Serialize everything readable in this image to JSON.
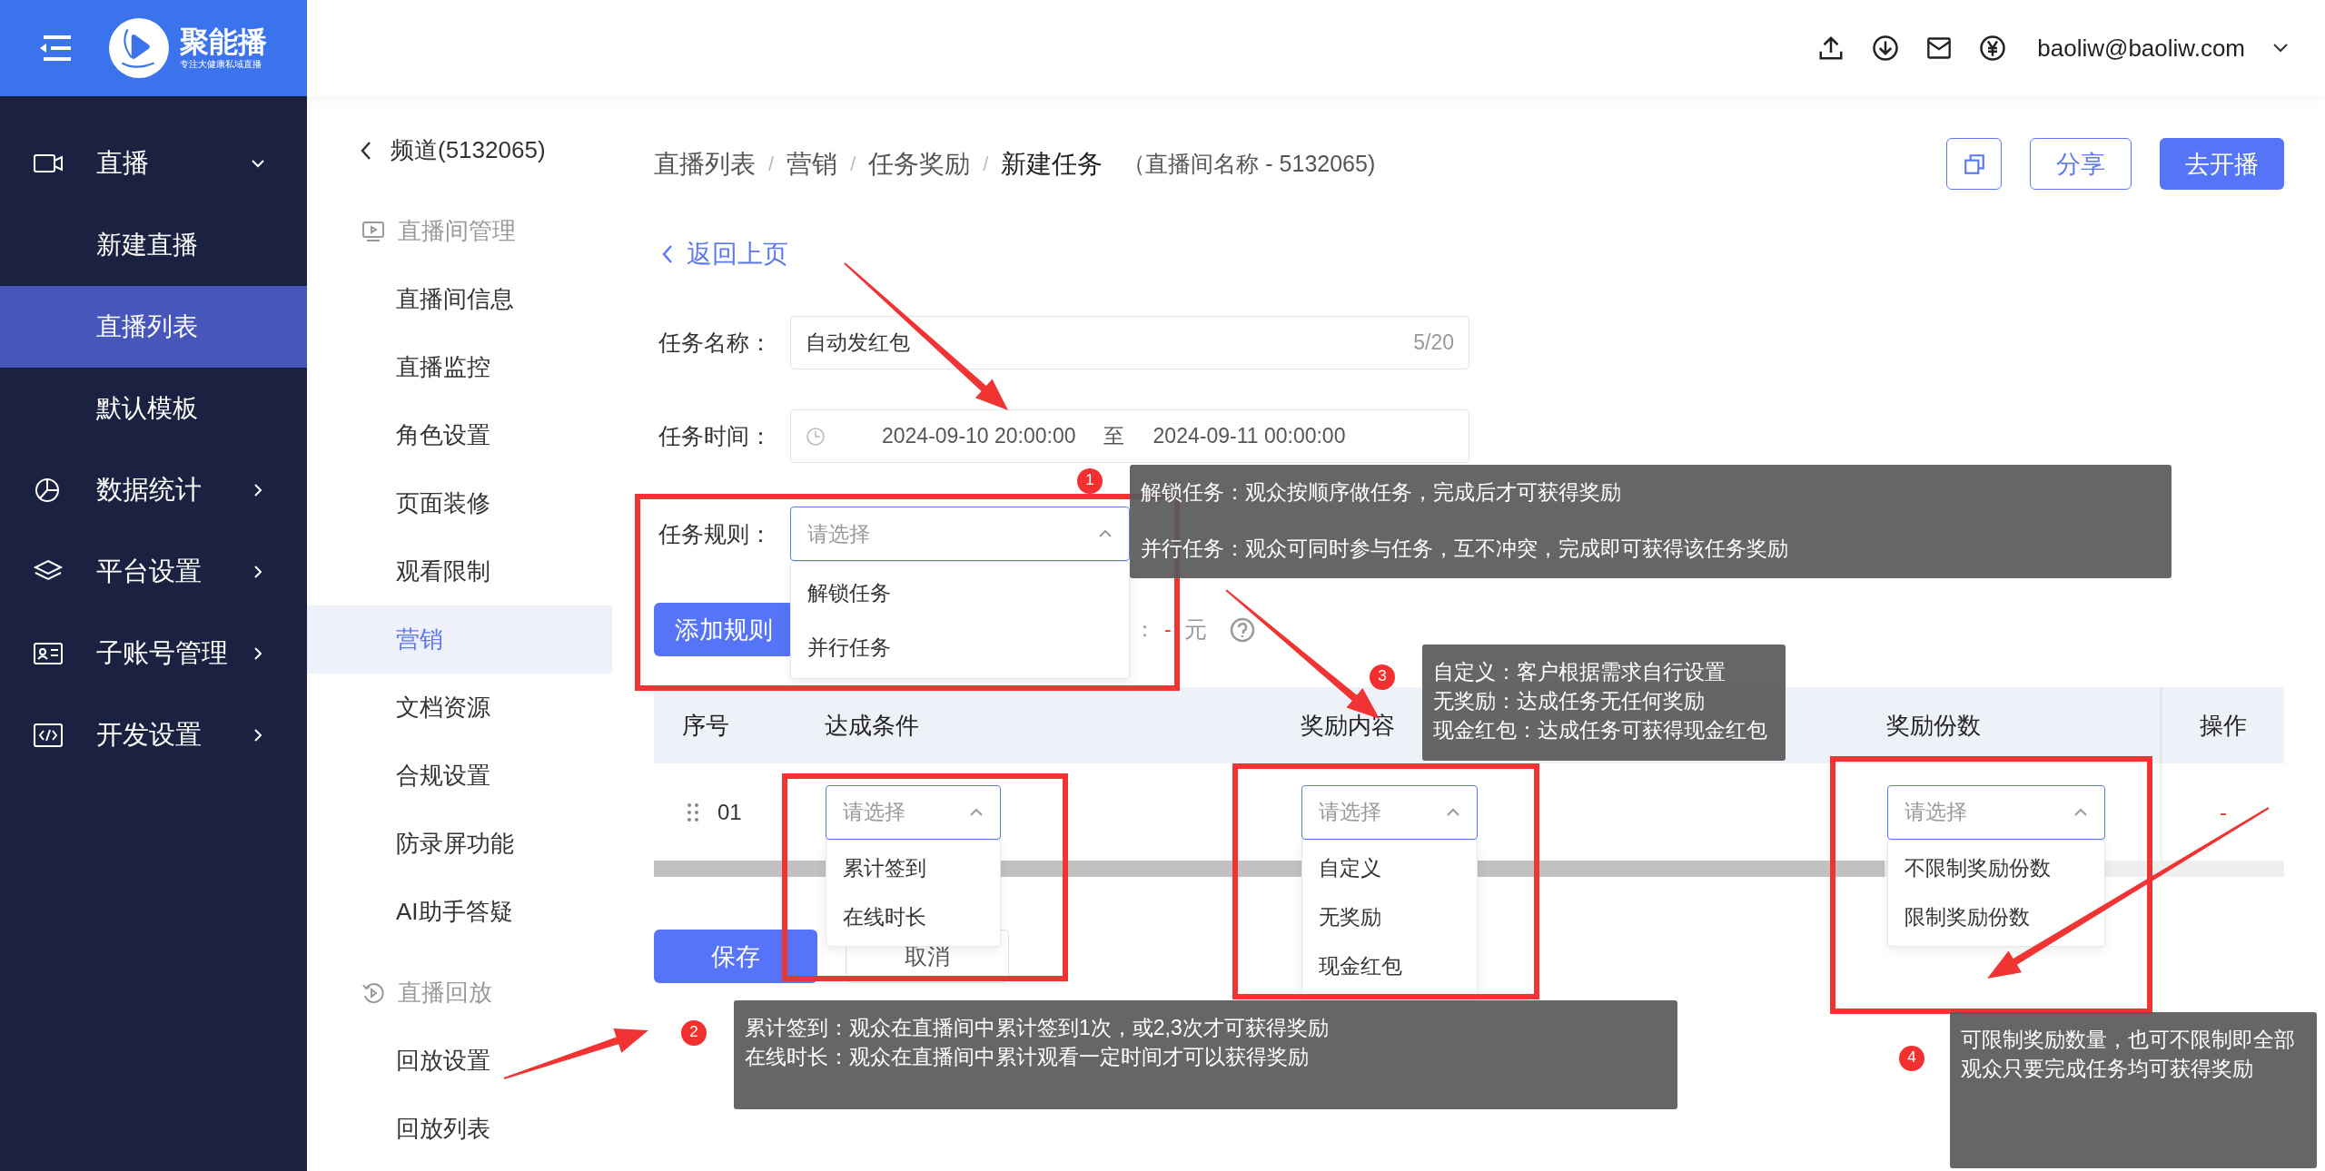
{
  "header": {
    "brand": "聚能播",
    "slogan": "专注大健康私域直播",
    "user": "baoliw@baoliw.com"
  },
  "nav": [
    {
      "label": "直播",
      "expanded": true,
      "children": [
        {
          "label": "新建直播",
          "selected": false
        },
        {
          "label": "直播列表",
          "selected": true
        },
        {
          "label": "默认模板",
          "selected": false
        }
      ]
    },
    {
      "label": "数据统计",
      "expanded": false
    },
    {
      "label": "平台设置",
      "expanded": false
    },
    {
      "label": "子账号管理",
      "expanded": false
    },
    {
      "label": "开发设置",
      "expanded": false
    }
  ],
  "subnav": {
    "title": "频道(5132065)",
    "groups": [
      {
        "title": "直播间管理",
        "items": [
          {
            "label": "直播间信息",
            "selected": false
          },
          {
            "label": "直播监控",
            "selected": false
          },
          {
            "label": "角色设置",
            "selected": false
          },
          {
            "label": "页面装修",
            "selected": false
          },
          {
            "label": "观看限制",
            "selected": false
          },
          {
            "label": "营销",
            "selected": true
          },
          {
            "label": "文档资源",
            "selected": false
          },
          {
            "label": "合规设置",
            "selected": false
          },
          {
            "label": "防录屏功能",
            "selected": false
          },
          {
            "label": "AI助手答疑",
            "selected": false
          }
        ]
      },
      {
        "title": "直播回放",
        "items": [
          {
            "label": "回放设置",
            "selected": false
          },
          {
            "label": "回放列表",
            "selected": false
          }
        ]
      }
    ]
  },
  "breadcrumb": [
    {
      "kind": "link",
      "label": "直播列表",
      "current": false
    },
    {
      "kind": "separator",
      "label": "/"
    },
    {
      "kind": "link",
      "label": "营销",
      "current": false
    },
    {
      "kind": "separator",
      "label": "/"
    },
    {
      "kind": "link",
      "label": "任务奖励",
      "current": false
    },
    {
      "kind": "separator",
      "label": "/"
    },
    {
      "kind": "link",
      "label": "新建任务",
      "current": true
    }
  ],
  "room_note": "（直播间名称 - 5132065)",
  "actions": [
    {
      "kind": "icon"
    },
    {
      "kind": "outline",
      "label": "分享"
    },
    {
      "kind": "primary",
      "label": "去开播"
    }
  ],
  "back_link": "返回上页",
  "form": {
    "name": {
      "label": "任务名称：",
      "value": "自动发红包",
      "count": "5/20"
    },
    "time": {
      "label": "任务时间：",
      "start": "2024-09-10 20:00:00",
      "separator": "至",
      "end": "2024-09-11 00:00:00"
    },
    "rule": {
      "label": "任务规则：",
      "placeholder": "请选择",
      "expanded": true,
      "options": [
        "解锁任务",
        "并行任务"
      ]
    },
    "add_rule": "添加规则",
    "hidden_label": "：",
    "amount": "-",
    "unit": "元"
  },
  "table": {
    "columns": [
      "序号",
      "达成条件",
      "奖励内容",
      "奖励份数",
      "操作"
    ],
    "rows": [
      {
        "cells": [
          {
            "kind": "number",
            "text": "01"
          },
          {
            "kind": "select",
            "placeholder": "请选择",
            "expanded": true,
            "options": [
              "累计签到",
              "在线时长"
            ]
          },
          {
            "kind": "select",
            "placeholder": "请选择",
            "expanded": true,
            "options": [
              "自定义",
              "无奖励",
              "现金红包"
            ]
          },
          {
            "kind": "select",
            "placeholder": "请选择",
            "expanded": true,
            "options": [
              "不限制奖励份数",
              "限制奖励份数"
            ]
          },
          {
            "kind": "action",
            "text": "-"
          }
        ]
      }
    ]
  },
  "buttons": {
    "save": "保存",
    "cancel": "取消"
  },
  "notes": [
    {
      "number": "1",
      "lines": [
        "解锁任务：观众按顺序做任务，完成后才可获得奖励",
        "并行任务：观众可同时参与任务，互不冲突，完成即可获得该任务奖励"
      ]
    },
    {
      "number": "2",
      "lines": [
        "累计签到：观众在直播间中累计签到1次，或2,3次才可获得奖励",
        "在线时长：观众在直播间中累计观看一定时间才可以获得奖励"
      ]
    },
    {
      "number": "3",
      "lines": [
        "自定义：客户根据需求自行设置",
        "无奖励：达成任务无任何奖励",
        "现金红包：达成任务可获得现金红包"
      ]
    },
    {
      "number": "4",
      "lines": [
        "可限制奖励数量，也可不限制即全部",
        "观众只要完成任务均可获得奖励"
      ]
    }
  ]
}
